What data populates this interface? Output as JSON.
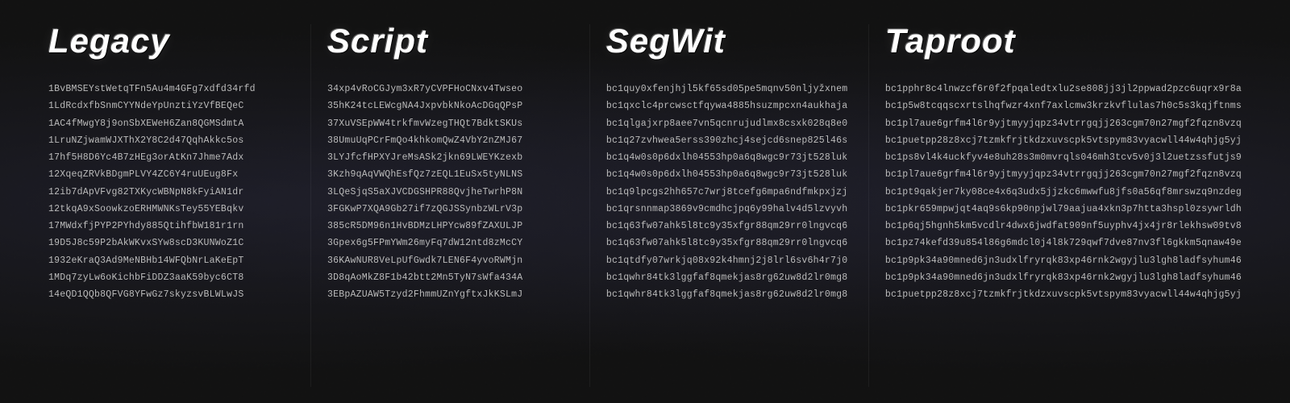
{
  "columns": [
    {
      "id": "legacy",
      "title": "Legacy",
      "addresses": [
        "1BvBMSEYstWetqTFn5Au4m4GFg7xdfd34rfd",
        "1LdRcdxfbSnmCYYNdeYpUnztiYzVfBEQeC",
        "1AC4fMwgY8j9onSbXEWeH6Zan8QGMSdmtA",
        "1LruNZjwamWJXThX2Y8C2d47QqhAkkc5os",
        "17hf5H8D6Yc4B7zHEg3orAtKn7Jhme7Adx",
        "12XqeqZRVkBDgmPLVY4ZC6Y4ruUEug8Fx",
        "12ib7dApVFvg82TXKycWBNpN8kFyiAN1dr",
        "12tkqA9xSoowkzoERHMWNKsTey55YEBqkv",
        "17MWdxfjPYP2PYhdy885QtihfbW181r1rn",
        "19D5J8c59P2bAkWKvxSYw8scD3KUNWoZ1C",
        "1932eKraQ3Ad9MeNBHb14WFQbNrLaKeEpT",
        "1MDq7zyLw6oKichbFiDDZ3aaK59byc6CT8",
        "14eQD1QQb8QFVG8YFwGz7skyzsvBLWLwJS"
      ]
    },
    {
      "id": "script",
      "title": "Script",
      "addresses": [
        "34xp4vRoCGJym3xR7yCVPFHoCNxv4Twseo",
        "35hK24tcLEWcgNA4JxpvbkNkoAcDGqQPsP",
        "37XuVSEpWW4trkfmvWzegTHQt7BdktSKUs",
        "38UmuUqPCrFmQo4khkomQwZ4VbY2nZMJ67",
        "3LYJfcfHPXYJreMsASk2jkn69LWEYKzexb",
        "3Kzh9qAqVWQhEsfQz7zEQL1EuSx5tyNLNS",
        "3LQeSjqS5aXJVCDGSHPR88QvjheTwrhP8N",
        "3FGKwP7XQA9Gb27if7zQGJSSynbzWLrV3p",
        "385cR5DM96n1HvBDMzLHPYcw89fZAXULJP",
        "3Gpex6g5FPmYWm26myFq7dW12ntd8zMcCY",
        "36KAwNUR8VeLpUfGwdk7LEN6F4yvoRWMjn",
        "3D8qAoMkZ8F1b42btt2Mn5TyN7sWfa434A",
        "3EBpAZUAW5Tzyd2FhmmUZnYgftxJkKSLmJ"
      ]
    },
    {
      "id": "segwit",
      "title": "SegWit",
      "addresses": [
        "bc1quy0xfenjhjl5kf65sd05pe5mqnv50nljyžxnem",
        "bc1qxclc4prcwsctfqywa4885hsuzmpcxn4aukhaja",
        "bc1qlgajxrp8aee7vn5qcnrujudlmx8csxk028q8e0",
        "bc1q27zvhwea5erss390zhcj4sejcd6snep825l46s",
        "bc1q4w0s0p6dxlh04553hp0a6q8wgc9r73jt528luk",
        "bc1q4w0s0p6dxlh04553hp0a6q8wgc9r73jt528luk",
        "bc1q9lpcgs2hh657c7wrj8tcefg6mpa6ndfmkpxjzj",
        "bc1qrsnnmap3869v9cmdhcjpq6y99halv4d5lzvyvh",
        "bc1q63fw07ahk5l8tc9y35xfgr88qm29rr0lngvcq6",
        "bc1q63fw07ahk5l8tc9y35xfgr88qm29rr0lngvcq6",
        "bc1qtdfy07wrkjq08x92k4hmnj2j8lrl6sv6h4r7j0",
        "bc1qwhr84tk3lggfaf8qmekjas8rg62uw8d2lr0mg8",
        "bc1qwhr84tk3lggfaf8qmekjas8rg62uw8d2lr0mg8"
      ],
      "highlights": [
        6,
        1
      ]
    },
    {
      "id": "taproot",
      "title": "Taproot",
      "addresses": [
        "bc1pphr8c4lnwzcf6r0f2fpqaledtxlu2se808jj3jl2ppwad2pzc6uqrx9r8a",
        "bc1p5w8tcqqscxrtslhqfwzr4xnf7axlcmw3krzkvflulas7h0c5s3kqjftnms",
        "bc1pl7aue6grfm4l6r9yjtmyyjqpz34vtrrgqjj263cgm70n27mgf2fqzn8vzq",
        "bc1puetpp28z8xcj7tzmkfrjtkdzxuvscpk5vtspym83vyacwll44w4qhjg5yj",
        "bc1ps8vl4k4uckfyv4e8uh28s3m0mvrqls046mh3tcv5v0j3l2uetzssfutjs9",
        "bc1pl7aue6grfm4l6r9yjtmyyjqpz34vtrrgqjj263cgm70n27mgf2fqzn8vzq",
        "bc1pt9qakjer7ky08ce4x6q3udx5jjzkc6mwwfu8jfs0a56qf8mrswzq9nzdeg",
        "bc1pkr659mpwjqt4aq9s6kp90npjwl79aajua4xkn3p7htta3hspl0zsywrldh",
        "bc1p6qj5hgnh5km5vcdlr4dwx6jwdfat909nf5uyphv4jx4jr8rlekhsw09tv8",
        "bc1pz74kefd39u854l86g6mdcl0j4l8k729qwf7dve87nv3fl6gkkm5qnaw49e",
        "bc1p9pk34a90mned6jn3udxlfryrqk83xp46rnk2wgyjlu3lgh8ladfsyhum46",
        "bc1p9pk34a90mned6jn3udxlfryrqk83xp46rnk2wgyjlu3lgh8ladfsyhum46",
        "bc1puetpp28z8xcj7tzmkfrjtkdzxuvscpk5vtspym83vyacwll44w4qhjg5yj"
      ]
    }
  ]
}
